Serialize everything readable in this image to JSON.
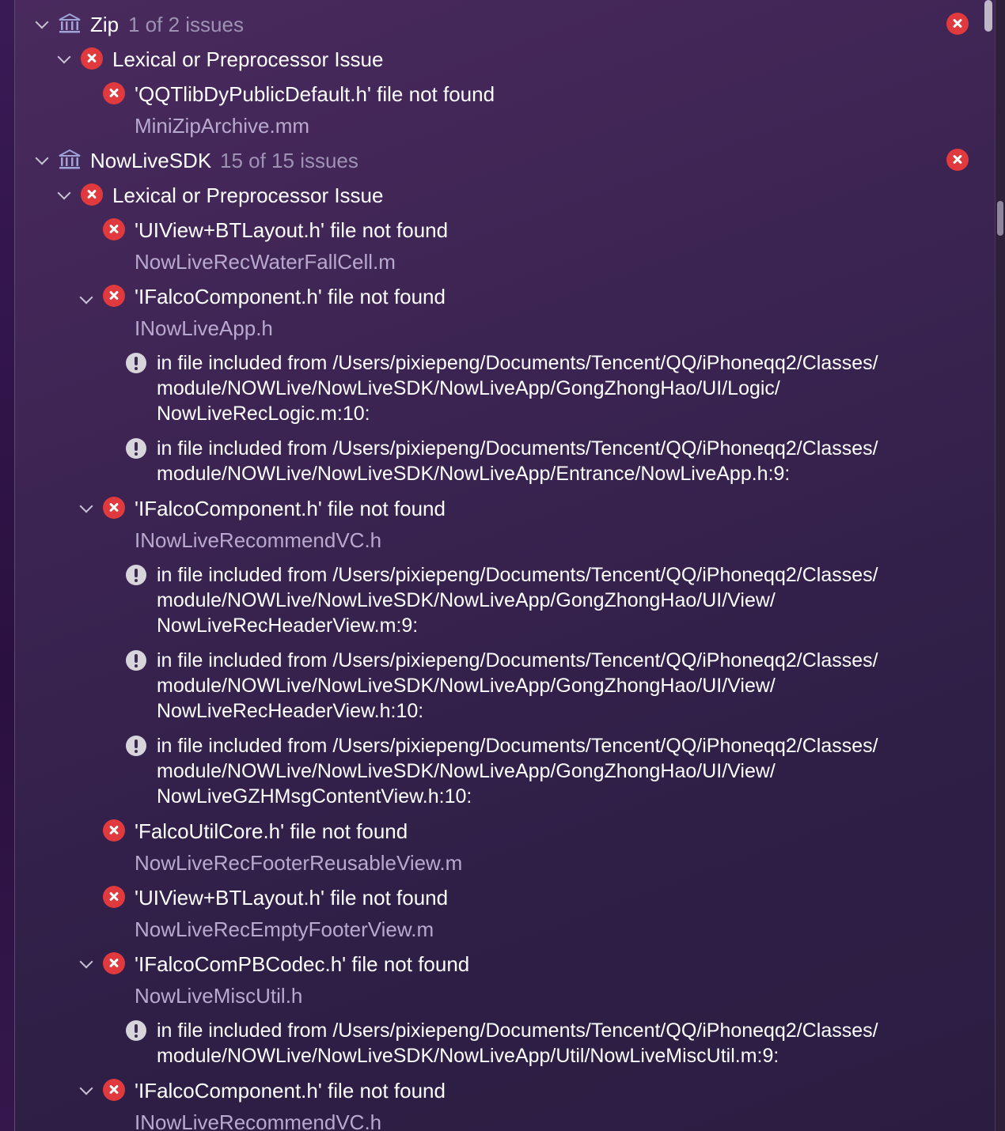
{
  "groups": [
    {
      "name": "Zip",
      "count": "1 of 2 issues",
      "category": "Lexical or Preprocessor Issue",
      "issues": [
        {
          "message": "'QQTlibDyPublicDefault.h' file not found",
          "file": "MiniZipArchive.mm"
        }
      ]
    },
    {
      "name": "NowLiveSDK",
      "count": "15 of 15 issues",
      "category": "Lexical or Preprocessor Issue",
      "issues": [
        {
          "message": "'UIView+BTLayout.h' file not found",
          "file": "NowLiveRecWaterFallCell.m"
        },
        {
          "message": "'IFalcoComponent.h' file not found",
          "file": "INowLiveApp.h",
          "notes": [
            "in file included from /Users/pixiepeng/Documents/Tencent/QQ/iPhoneqq2/Classes/ module/NOWLive/NowLiveSDK/NowLiveApp/GongZhongHao/UI/Logic/ NowLiveRecLogic.m:10:",
            "in file included from /Users/pixiepeng/Documents/Tencent/QQ/iPhoneqq2/Classes/ module/NOWLive/NowLiveSDK/NowLiveApp/Entrance/NowLiveApp.h:9:"
          ]
        },
        {
          "message": "'IFalcoComponent.h' file not found",
          "file": "INowLiveRecommendVC.h",
          "notes": [
            "in file included from /Users/pixiepeng/Documents/Tencent/QQ/iPhoneqq2/Classes/ module/NOWLive/NowLiveSDK/NowLiveApp/GongZhongHao/UI/View/ NowLiveRecHeaderView.m:9:",
            "in file included from /Users/pixiepeng/Documents/Tencent/QQ/iPhoneqq2/Classes/ module/NOWLive/NowLiveSDK/NowLiveApp/GongZhongHao/UI/View/ NowLiveRecHeaderView.h:10:",
            "in file included from /Users/pixiepeng/Documents/Tencent/QQ/iPhoneqq2/Classes/ module/NOWLive/NowLiveSDK/NowLiveApp/GongZhongHao/UI/View/ NowLiveGZHMsgContentView.h:10:"
          ]
        },
        {
          "message": "'FalcoUtilCore.h' file not found",
          "file": "NowLiveRecFooterReusableView.m"
        },
        {
          "message": "'UIView+BTLayout.h' file not found",
          "file": "NowLiveRecEmptyFooterView.m"
        },
        {
          "message": "'IFalcoComPBCodec.h' file not found",
          "file": "NowLiveMiscUtil.h",
          "notes": [
            "in file included from /Users/pixiepeng/Documents/Tencent/QQ/iPhoneqq2/Classes/ module/NOWLive/NowLiveSDK/NowLiveApp/Util/NowLiveMiscUtil.m:9:"
          ]
        },
        {
          "message": "'IFalcoComponent.h' file not found",
          "file": "INowLiveRecommendVC.h"
        }
      ]
    }
  ],
  "colors": {
    "error": "#e03a3e",
    "warning": "#d8d4dc",
    "file_text": "#b9a9cf",
    "count_text": "#9f92b4"
  },
  "icons": {
    "group": "library-icon",
    "error": "error-x-icon",
    "warning": "exclamation-icon",
    "disclosure": "chevron-down-icon"
  }
}
